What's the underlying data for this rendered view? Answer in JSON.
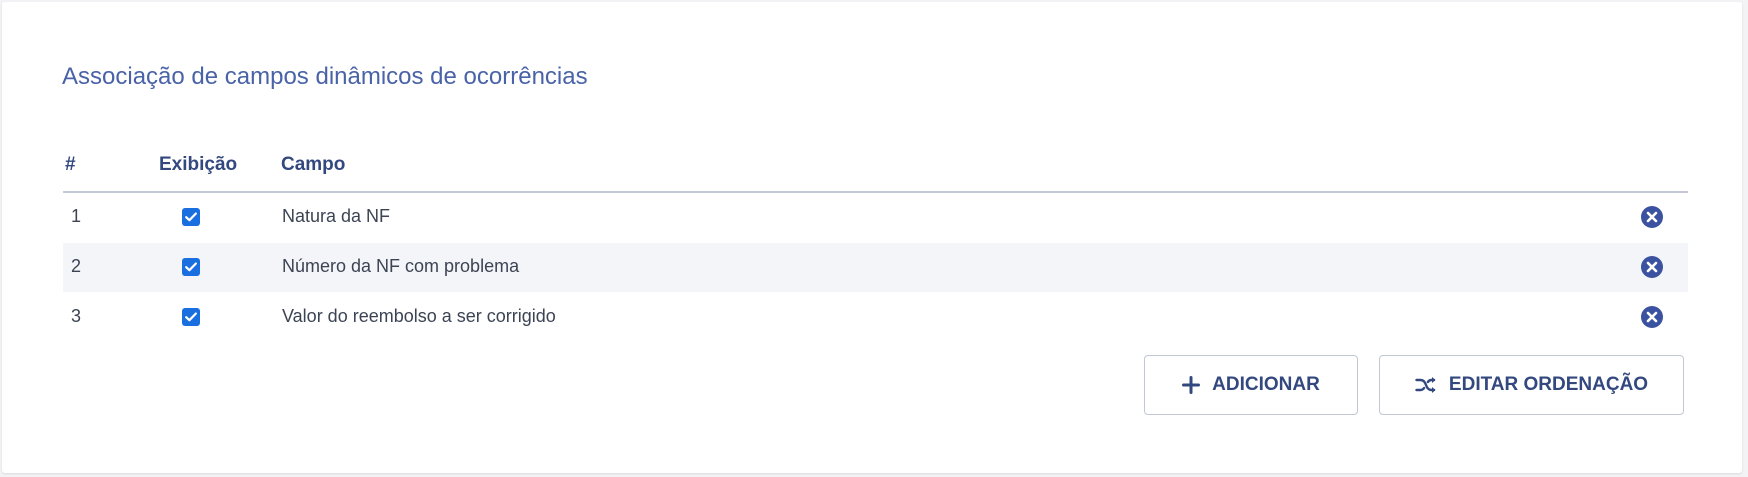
{
  "panel": {
    "title": "Associação de campos dinâmicos de ocorrências"
  },
  "table": {
    "headers": {
      "index": "#",
      "display": "Exibição",
      "field": "Campo"
    },
    "rows": [
      {
        "index": "1",
        "checked": true,
        "field": "Natura da NF"
      },
      {
        "index": "2",
        "checked": true,
        "field": "Número da NF com problema"
      },
      {
        "index": "3",
        "checked": true,
        "field": "Valor do reembolso a ser corrigido"
      }
    ]
  },
  "actions": {
    "add_label": "ADICIONAR",
    "add_icon": "plus-icon",
    "edit_order_label": "EDITAR ORDENAÇÃO",
    "edit_order_icon": "shuffle-icon"
  },
  "colors": {
    "accent": "#33487f",
    "title": "#4a63a8",
    "checkbox": "#1a6fe0",
    "remove_icon": "#3a52a0"
  }
}
